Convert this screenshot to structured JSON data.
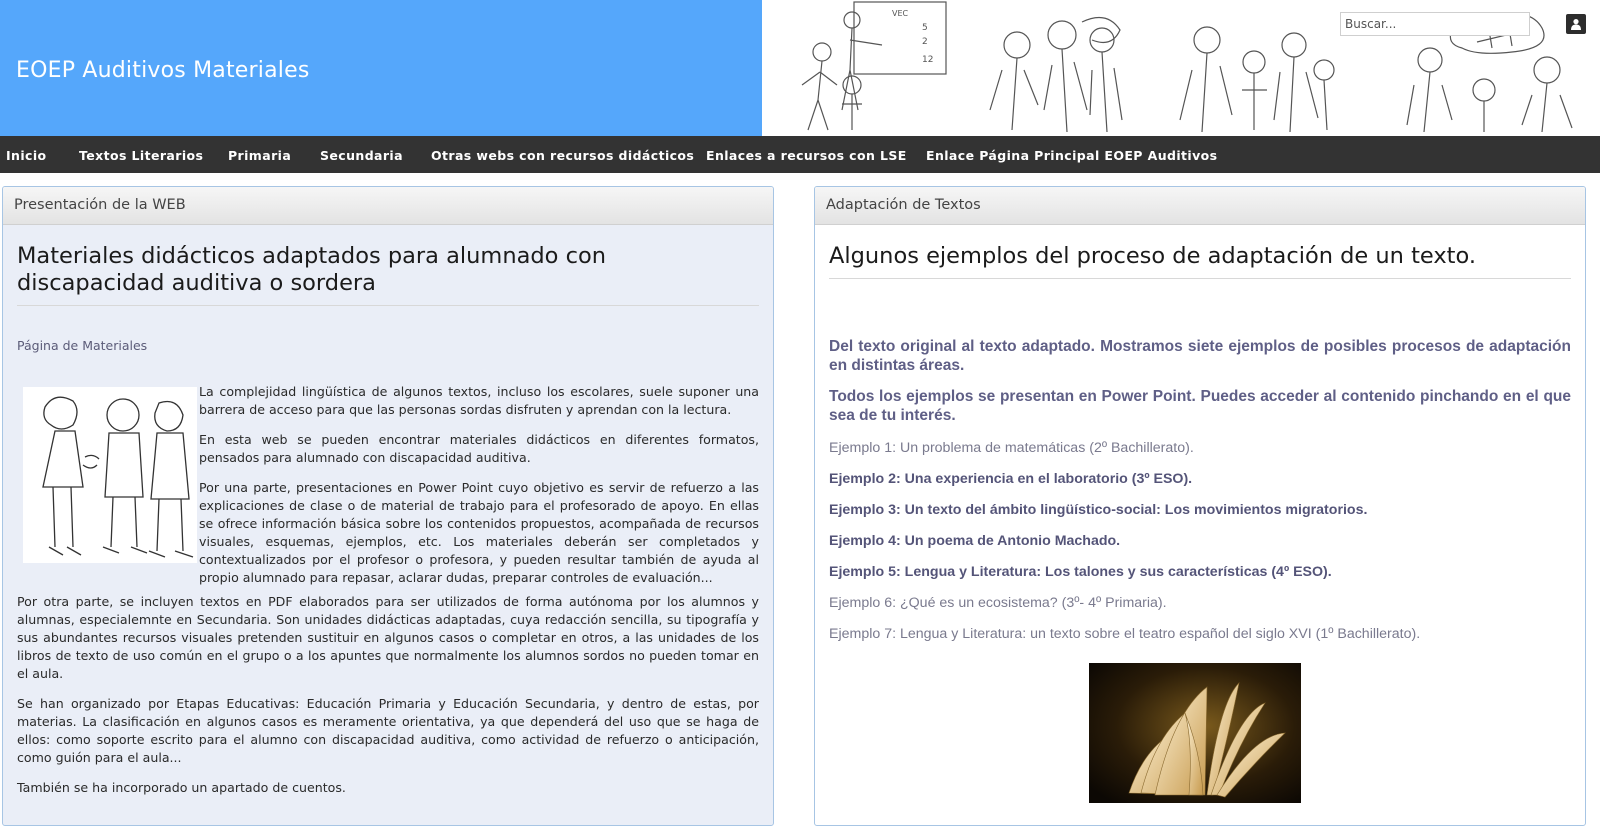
{
  "header": {
    "site_title": "EOEP Auditivos Materiales",
    "search_placeholder": "Buscar..."
  },
  "nav": {
    "items": [
      "Inicio",
      "Textos Literarios",
      "Primaria",
      "Secundaria",
      "Otras webs con recursos didácticos",
      "Enlaces a recursos con LSE",
      "Enlace Página Principal EOEP Auditivos"
    ]
  },
  "left_panel": {
    "header": "Presentación de la WEB",
    "title": "Materiales didácticos adaptados para alumnado con discapacidad auditiva o sordera",
    "materials_link": "Página de Materiales",
    "paragraphs": [
      "La complejidad lingüística de algunos textos, incluso los escolares, suele suponer una barrera de acceso para que las personas sordas disfruten y aprendan con la lectura.",
      "En esta web se pueden encontrar materiales didácticos en diferentes formatos, pensados para alumnado con discapacidad auditiva.",
      "Por una parte, presentaciones en Power Point cuyo objetivo es servir de refuerzo a las explicaciones de clase o de material de trabajo para el profesorado de apoyo. En ellas se ofrece información básica sobre los contenidos propuestos, acompañada de recursos visuales, esquemas, ejemplos, etc. Los materiales deberán ser completados y contextualizados por el profesor o profesora, y pueden resultar también de ayuda al propio alumnado para repasar, aclarar dudas, preparar controles de evaluación...",
      "Por otra parte, se incluyen textos en PDF elaborados para ser utilizados de forma autónoma por los alumnos y alumnas, especialemnte en Secundaria. Son unidades didácticas adaptadas, cuya redacción sencilla, su tipografía y sus abundantes recursos visuales pretenden sustituir en algunos casos o completar en otros, a las unidades de los libros de texto de uso común en el grupo o a los apuntes que normalmente los alumnos sordos no pueden tomar en el aula.",
      "Se han organizado por Etapas Educativas: Educación Primaria y Educación Secundaria, y dentro de estas, por materias. La clasificación en algunos casos es meramente orientativa, ya que dependerá del uso que se haga de ellos: como soporte escrito para el alumno con discapacidad auditiva, como actividad de refuerzo o anticipación, como guión para el aula...",
      "También se ha incorporado un apartado de cuentos."
    ]
  },
  "right_panel": {
    "header": "Adaptación de Textos",
    "title": "Algunos ejemplos del proceso de adaptación de un texto.",
    "intro_1": "Del texto original al texto adaptado. Mostramos siete ejemplos de posibles procesos de adaptación en distintas áreas.",
    "intro_2": "Todos los ejemplos se presentan en Power Point. Puedes acceder al contenido pinchando en el que sea de tu interés.",
    "examples": [
      "Ejemplo 1: Un problema de matemáticas (2º Bachillerato).",
      "Ejemplo 2:  Una experiencia en el laboratorio (3º ESO).",
      "Ejemplo 3: Un texto del ámbito lingüístico-social: Los movimientos migratorios.",
      "Ejemplo 4: Un poema de Antonio Machado.",
      "Ejemplo 5: Lengua y Literatura: Los talones y sus características (4º ESO).",
      "Ejemplo 6: ¿Qué es un ecosistema? (3º- 4º Primaria).",
      "Ejemplo 7: Lengua y Literatura: un texto sobre el teatro español del siglo XVI (1º Bachillerato)."
    ]
  },
  "colors": {
    "header_blue": "#55a7fb",
    "nav_bg": "#333333",
    "panel_bg": "#eaeef7",
    "link_purple": "#5f5f86"
  }
}
